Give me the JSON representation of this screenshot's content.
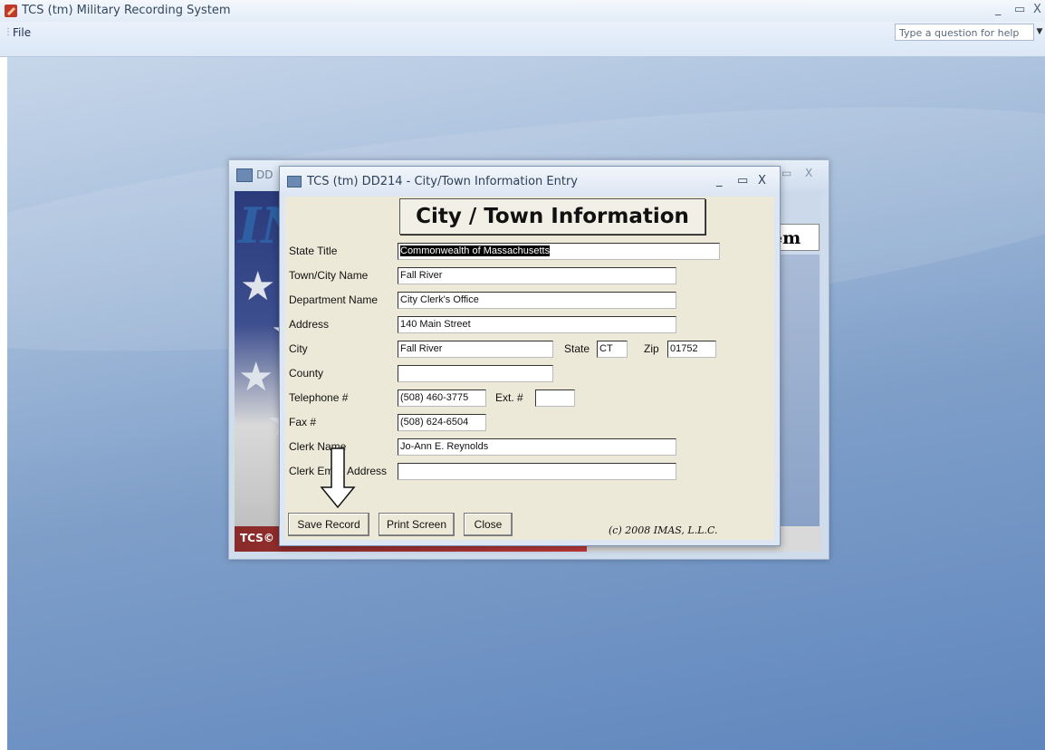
{
  "app": {
    "title": "TCS (tm) Military Recording System",
    "controls": {
      "minimize": "_",
      "restore": "▭",
      "close": "X"
    }
  },
  "menu": {
    "file": "File",
    "help_placeholder": "Type a question for help"
  },
  "background_window": {
    "title": "DD",
    "big_letter": "IN",
    "system_text": "em",
    "footer_logo": "TCS©",
    "controls": {
      "minimize": "_",
      "restore": "▭",
      "close": "X"
    }
  },
  "dialog": {
    "title": "TCS (tm) DD214 - City/Town Information Entry",
    "controls": {
      "minimize": "_",
      "restore": "▭",
      "close": "X"
    },
    "heading": "City / Town Information",
    "labels": {
      "state_title": "State Title",
      "town_city": "Town/City Name",
      "department": "Department Name",
      "address": "Address",
      "city": "City",
      "state": "State",
      "zip": "Zip",
      "county": "County",
      "telephone": "Telephone #",
      "ext": "Ext. #",
      "fax": "Fax #",
      "clerk_name": "Clerk Name",
      "clerk_email": "Clerk Email Address"
    },
    "values": {
      "state_title": "Commonwealth of Massachusetts",
      "town_city": "Fall River",
      "department": "City Clerk's Office",
      "address": "140 Main Street",
      "city": "Fall River",
      "state": "CT",
      "zip": "01752",
      "county": "",
      "telephone": "(508) 460-3775",
      "ext": "",
      "fax": "(508) 624-6504",
      "clerk_name": "Jo-Ann E. Reynolds",
      "clerk_email": ""
    },
    "buttons": {
      "save": "Save Record",
      "print": "Print Screen",
      "close": "Close"
    },
    "copyright": "(c) 2008 IMAS, L.L.C."
  }
}
